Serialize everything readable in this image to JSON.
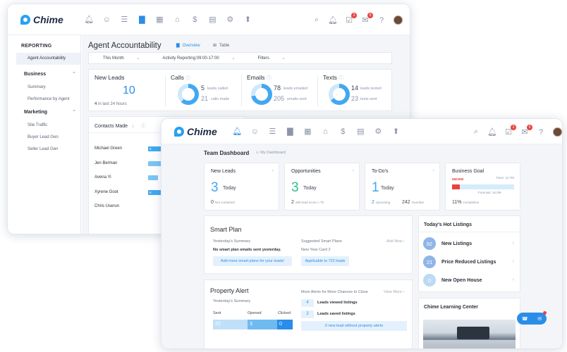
{
  "brand": "Chime",
  "win1": {
    "sidebar": {
      "header": "REPORTING",
      "items_top": [
        "Agent Accountability"
      ],
      "business": {
        "label": "Business",
        "items": [
          "Summary",
          "Performance by Agent"
        ]
      },
      "marketing": {
        "label": "Marketing",
        "items": [
          "Site Traffic",
          "Buyer Lead Gen",
          "Seller Lead Gen"
        ]
      }
    },
    "title": "Agent Accountability",
    "tabs": [
      "Overview",
      "Table"
    ],
    "filters": [
      "This Month",
      "Activity Reporting:09:00-17:00",
      "Filters"
    ],
    "new_leads": {
      "label": "New Leads",
      "value": "10",
      "foot_num": "4",
      "foot_text": "in last 24 hours"
    },
    "calls": {
      "label": "Calls",
      "a_num": "5",
      "a_lbl": "leads called",
      "b_num": "21",
      "b_lbl": "calls made"
    },
    "emails": {
      "label": "Emails",
      "a_num": "78",
      "a_lbl": "leads emailed",
      "b_num": "205",
      "b_lbl": "emails sent"
    },
    "texts": {
      "label": "Texts",
      "a_num": "14",
      "a_lbl": "leads texted",
      "b_num": "23",
      "b_lbl": "texts sent"
    },
    "contacts": {
      "header": "Contacts Made",
      "rows": [
        {
          "name": "Michael Green",
          "bar_label": "8"
        },
        {
          "name": "Jen Berman",
          "bar_label": ""
        },
        {
          "name": "Avena Yi",
          "bar_label": ""
        },
        {
          "name": "Xyrene Goot",
          "bar_label": "8"
        },
        {
          "name": "Chris Userun",
          "bar_label": ""
        }
      ]
    }
  },
  "win2": {
    "title": "Team Dashboard",
    "subtitle": "My Dashboard",
    "kpis": {
      "new_leads": {
        "label": "New Leads",
        "value": "3",
        "today": "Today",
        "foot_num": "0",
        "foot_lbl": "Not contacted"
      },
      "opportunities": {
        "label": "Opportunities",
        "value": "3",
        "today": "Today",
        "foot_num": "2",
        "foot_lbl": "with lead score > 70"
      },
      "todos": {
        "label": "To-Do's",
        "value": "1",
        "today": "Today",
        "up_num": "2",
        "up_lbl": "Upcoming",
        "over_num": "242",
        "over_lbl": "Overdue"
      },
      "goal": {
        "label": "Business Goal",
        "pace": "Pace: 12.7M",
        "current": "5M/40M",
        "forecast": "Forecast: 16.0M",
        "pct": "11%",
        "pct_lbl": "Completion",
        "fill_fraction": 0.125
      }
    },
    "smart_plan": {
      "title": "Smart Plan",
      "yesterday": "Yesterday's Summary",
      "none_sent": "No smart plan emails sent yesterday.",
      "add_more": "Add more smart plans for your leads!",
      "suggested": "Suggested Smart Plans",
      "add_now": "Add Now",
      "plan_name": "New Year Card 2",
      "applicable": "Applicable to 722 leads"
    },
    "property_alert": {
      "title": "Property Alert",
      "yesterday": "Yesterday's Summary",
      "cols": [
        "Sent",
        "Opened",
        "Clicked"
      ],
      "values": [
        "22",
        "3",
        "0"
      ],
      "more": "More Alerts for More Chances to Close",
      "view_more": "View More",
      "viewed_num": "4",
      "viewed_lbl": "Leads viewed listings",
      "saved_num": "2",
      "saved_lbl": "Leads saved listings",
      "no_prop": "0 new lead without property alerts"
    },
    "hot": {
      "title": "Today's Hot Listings",
      "items": [
        {
          "num": "92",
          "label": "New Listings",
          "color": "#8fb6e6"
        },
        {
          "num": "21",
          "label": "Price Reduced Listings",
          "color": "#8fb6e6"
        },
        {
          "num": "0",
          "label": "New Open House",
          "color": "#bcdaf6"
        }
      ]
    },
    "learning": {
      "title": "Chime Learning Center"
    }
  },
  "badges": {
    "b1": "3",
    "b2": "5"
  },
  "colors": {
    "accent": "#2a8de8",
    "ring": "#42a8f0",
    "ring_pale": "#cfe7fb",
    "green": "#2cbf86",
    "red": "#e6443d"
  }
}
